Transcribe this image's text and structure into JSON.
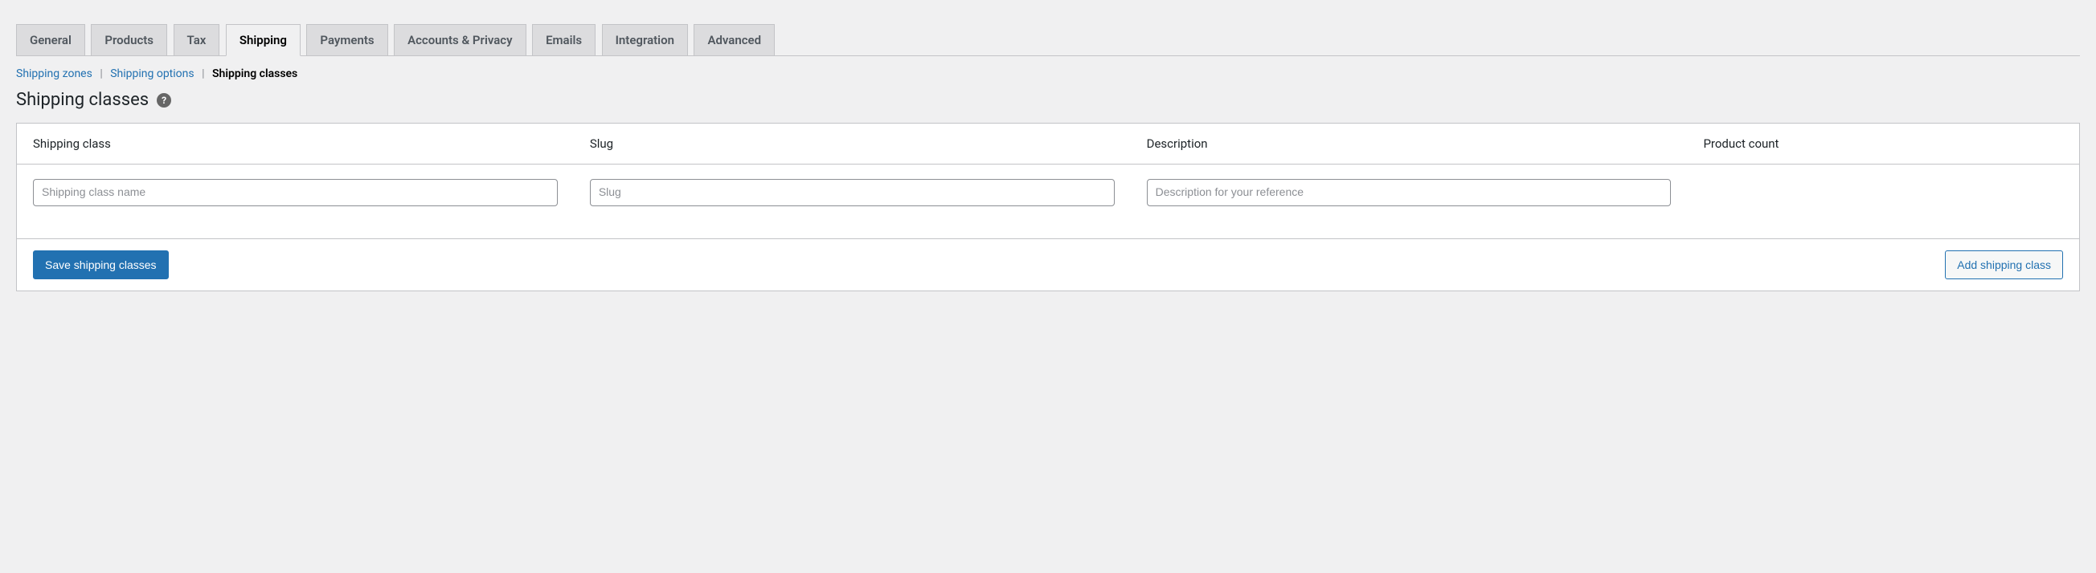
{
  "tabs": [
    {
      "label": "General",
      "active": false
    },
    {
      "label": "Products",
      "active": false
    },
    {
      "label": "Tax",
      "active": false
    },
    {
      "label": "Shipping",
      "active": true
    },
    {
      "label": "Payments",
      "active": false
    },
    {
      "label": "Accounts & Privacy",
      "active": false
    },
    {
      "label": "Emails",
      "active": false
    },
    {
      "label": "Integration",
      "active": false
    },
    {
      "label": "Advanced",
      "active": false
    }
  ],
  "subnav": {
    "zones": "Shipping zones",
    "options": "Shipping options",
    "classes": "Shipping classes"
  },
  "heading": "Shipping classes",
  "help_tip": "?",
  "table": {
    "headers": {
      "class": "Shipping class",
      "slug": "Slug",
      "description": "Description",
      "count": "Product count"
    },
    "row": {
      "class_placeholder": "Shipping class name",
      "slug_placeholder": "Slug",
      "desc_placeholder": "Description for your reference",
      "class_value": "",
      "slug_value": "",
      "desc_value": ""
    }
  },
  "buttons": {
    "save": "Save shipping classes",
    "add": "Add shipping class"
  }
}
